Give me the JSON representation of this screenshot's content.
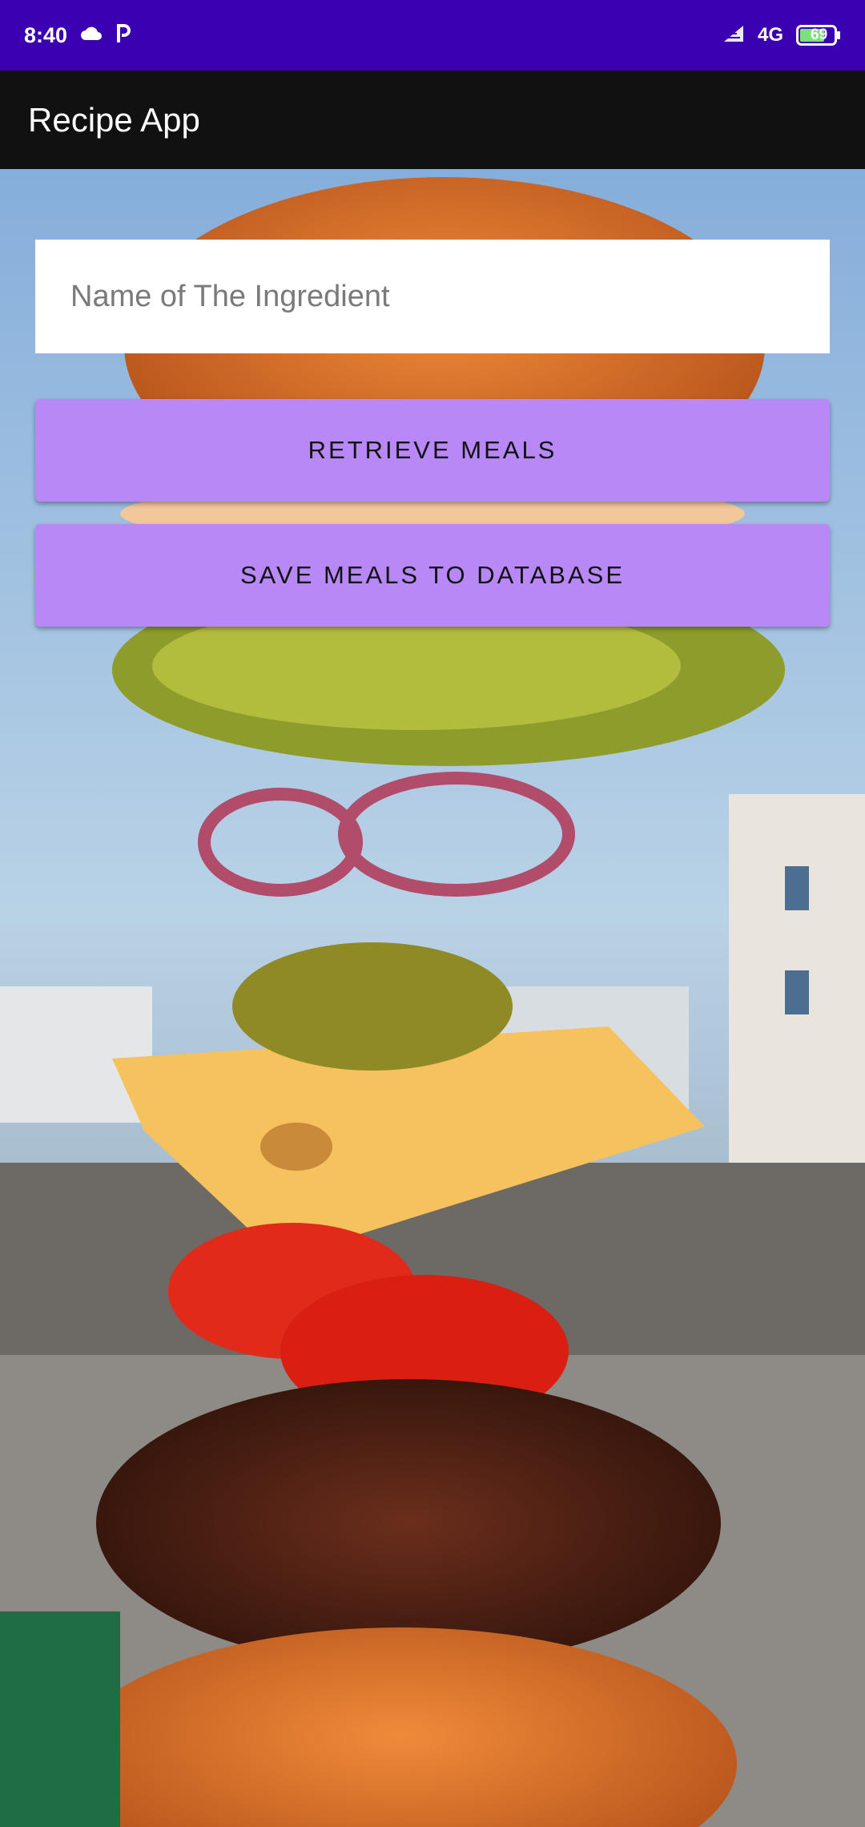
{
  "status_bar": {
    "time": "8:40",
    "network": "4G",
    "battery": "69",
    "icons": [
      "cloud-icon",
      "parking-icon",
      "signal-icon",
      "battery-icon"
    ]
  },
  "app_bar": {
    "title": "Recipe App"
  },
  "main": {
    "ingredient_input": {
      "value": "",
      "placeholder": "Name of The Ingredient"
    },
    "retrieve_button": "RETRIEVE MEALS",
    "save_button": "SAVE MEALS TO DATABASE"
  },
  "colors": {
    "status_bar": "#3a00b2",
    "app_bar": "#111111",
    "button": "#b888f7",
    "input_background": "#ffffff"
  }
}
